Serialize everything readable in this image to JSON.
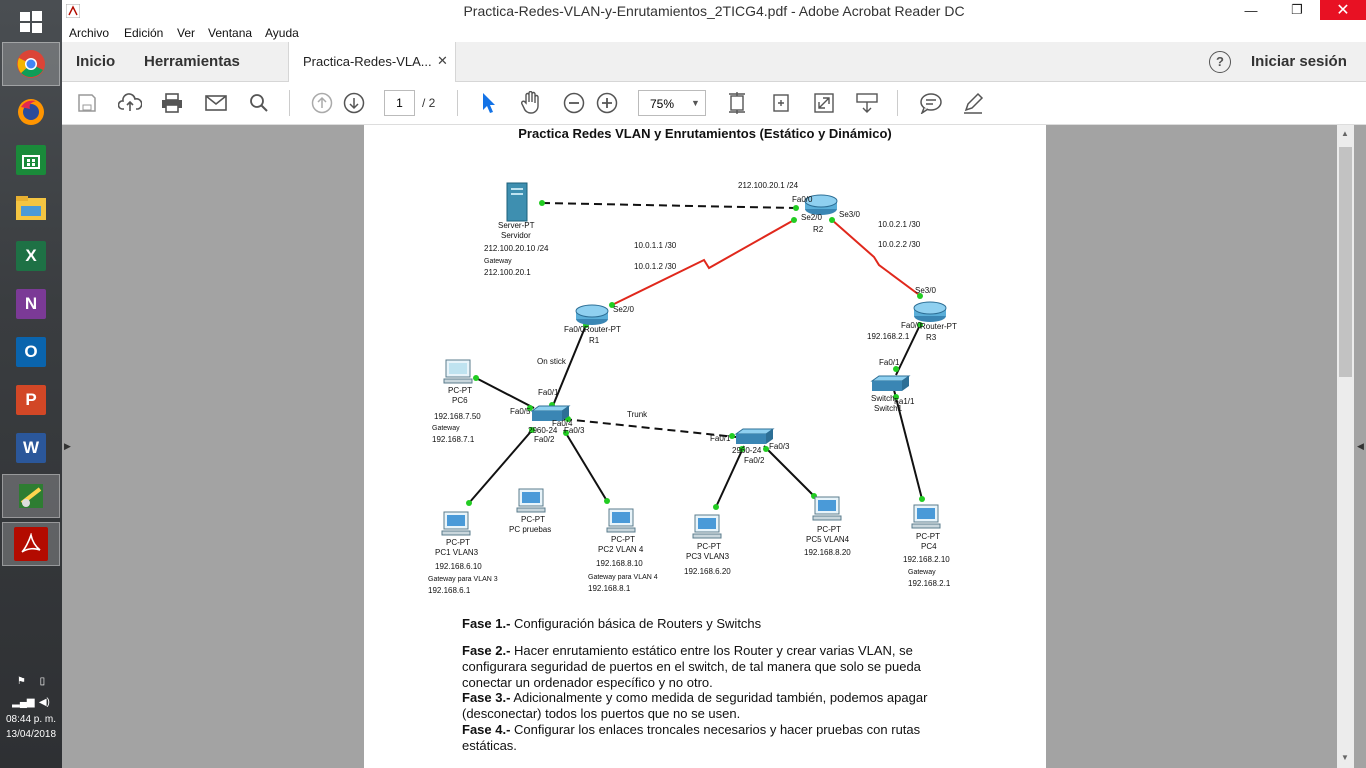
{
  "window": {
    "title": "Practica-Redes-VLAN-y-Enrutamientos_2TICG4.pdf - Adobe Acrobat Reader DC"
  },
  "menu": [
    "Archivo",
    "Edición",
    "Ver",
    "Ventana",
    "Ayuda"
  ],
  "nav": {
    "home": "Inicio",
    "tools": "Herramientas",
    "tab": "Practica-Redes-VLA...",
    "signin": "Iniciar sesión"
  },
  "toolbar": {
    "page_current": "1",
    "page_total": "/ 2",
    "zoom": "75%"
  },
  "taskbar": {
    "time": "08:44 p. m.",
    "date": "13/04/2018",
    "apps": [
      "chrome-icon",
      "firefox-icon",
      "store-icon",
      "file-explorer-icon",
      "excel-icon",
      "onenote-icon",
      "outlook-icon",
      "powerpoint-icon",
      "word-icon",
      "packet-tracer-icon",
      "acrobat-icon"
    ]
  },
  "document": {
    "heading": "Practica Redes VLAN y Enrutamientos (Estático y Dinámico)",
    "diagram": {
      "server": [
        "Server-PT",
        "Servidor",
        "212.100.20.10 /24",
        "Gateway",
        "212.100.20.1"
      ],
      "r2": [
        "212.100.20.1 /24",
        "Fa0/0",
        "Se2/0",
        "Se3/0",
        "R2"
      ],
      "links": [
        "10.0.1.1 /30",
        "10.0.1.2 /30",
        "10.0.2.1 /30",
        "10.0.2.2 /30"
      ],
      "r1": [
        "Se2/0",
        "Fa0/0",
        "Router-PT",
        "R1",
        "On stick"
      ],
      "r3": [
        "Se3/0",
        "Fa0/0",
        "Router-PT",
        "R3",
        "192.168.2.1"
      ],
      "pc6": [
        "PC-PT",
        "PC6",
        "192.168.7.50",
        "Gateway",
        "192.168.7.1"
      ],
      "sw1": [
        "Fa0/1",
        "Fa0/5",
        "Fa0/4",
        "Fa0/3",
        "2960-24",
        "Fa0/2",
        "Trunk"
      ],
      "sw2": [
        "Fa0/1",
        "2960-24",
        "Fa0/2",
        "Fa0/3"
      ],
      "sw3": [
        "Fa0/1",
        "Switch",
        "Switch1",
        "Fa1/1"
      ],
      "pc1": [
        "PC-PT",
        "PC1 VLAN3",
        "192.168.6.10",
        "Gateway para VLAN 3",
        "192.168.6.1"
      ],
      "pcp": [
        "PC-PT",
        "PC pruebas"
      ],
      "pc2": [
        "PC-PT",
        "PC2 VLAN 4",
        "192.168.8.10",
        "Gateway para VLAN 4",
        "192.168.8.1"
      ],
      "pc3": [
        "PC-PT",
        "PC3 VLAN3",
        "192.168.6.20"
      ],
      "pc5": [
        "PC-PT",
        "PC5 VLAN4",
        "192.168.8.20"
      ],
      "pc4": [
        "PC-PT",
        "PC4",
        "192.168.2.10",
        "Gateway",
        "192.168.2.1"
      ]
    },
    "phases": [
      {
        "label": "Fase 1.-",
        "text": " Configuración básica de Routers y Switchs"
      },
      {
        "label": "Fase 2.-",
        "text": " Hacer enrutamiento estático entre los Router y crear varias VLAN, se configurara seguridad de puertos en el switch, de tal manera que solo se pueda conectar un ordenador específico y no otro."
      },
      {
        "label": "Fase 3.-",
        "text": " Adicionalmente y como medida de seguridad también, podemos apagar (desconectar) todos los puertos que no se usen."
      },
      {
        "label": "Fase 4.-",
        "text": " Configurar los enlaces troncales necesarios y hacer pruebas con rutas estáticas."
      }
    ]
  }
}
